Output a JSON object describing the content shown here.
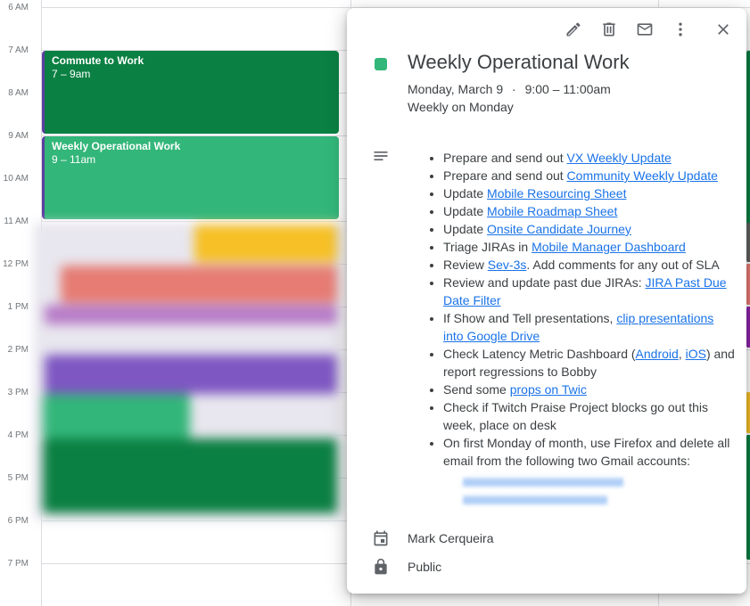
{
  "calendar": {
    "time_labels": [
      "6 AM",
      "7 AM",
      "8 AM",
      "9 AM",
      "10 AM",
      "11 AM",
      "12 PM",
      "1 PM",
      "2 PM",
      "3 PM",
      "4 PM",
      "5 PM",
      "6 PM",
      "7 PM"
    ],
    "events": [
      {
        "title": "Commute to Work",
        "time": "7 – 9am",
        "color": "#0b8043"
      },
      {
        "title": "Weekly Operational Work",
        "time": "9 – 11am",
        "color": "#33b679"
      }
    ]
  },
  "dialog": {
    "toolbar": {
      "edit": "edit-icon",
      "delete": "trash-icon",
      "email": "email-icon",
      "more": "more-vert-icon",
      "close": "close-icon"
    },
    "color": "#33b679",
    "title": "Weekly Operational Work",
    "date": "Monday, March 9",
    "separator": "·",
    "time": "9:00 – 11:00am",
    "repeat": "Weekly on Monday",
    "description": {
      "items": [
        {
          "pre": "Prepare and send out ",
          "link": "VX Weekly Update",
          "post": ""
        },
        {
          "pre": "Prepare and send out ",
          "link": "Community Weekly Update",
          "post": ""
        },
        {
          "pre": "Update ",
          "link": "Mobile Resourcing Sheet",
          "post": ""
        },
        {
          "pre": "Update ",
          "link": "Mobile Roadmap Sheet",
          "post": ""
        },
        {
          "pre": "Update ",
          "link": "Onsite Candidate Journey",
          "post": ""
        },
        {
          "pre": "Triage JIRAs in ",
          "link": "Mobile Manager Dashboard",
          "post": ""
        },
        {
          "pre": "Review ",
          "link": "Sev-3s",
          "post": ". Add comments for any out of SLA"
        },
        {
          "pre": "Review and update past due JIRAs: ",
          "link": "JIRA Past Due Date Filter",
          "post": ""
        },
        {
          "pre": "If Show and Tell presentations, ",
          "link": "clip presentations into Google Drive",
          "post": ""
        },
        {
          "pre": "Send some ",
          "link": "props on Twic",
          "post": ""
        },
        {
          "pre": "Check if Twitch Praise Project blocks go out this week, place on desk",
          "link": "",
          "post": ""
        },
        {
          "pre": "On first Monday of month, use Firefox and delete all email from the following two Gmail accounts:",
          "link": "",
          "post": ""
        }
      ],
      "latency": {
        "pre": "Check Latency Metric Dashboard (",
        "link1": "Android",
        "mid": ", ",
        "link2": "iOS",
        "post": ") and report regressions to Bobby"
      }
    },
    "owner": "Mark Cerqueira",
    "visibility": "Public"
  }
}
